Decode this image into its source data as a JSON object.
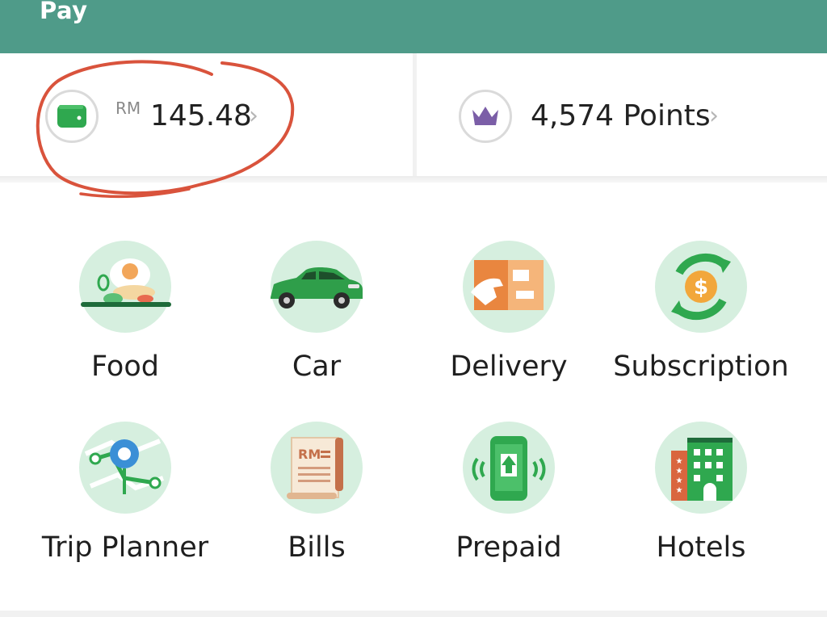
{
  "header": {
    "title": "Pay"
  },
  "wallet": {
    "currency": "RM",
    "amount": "145.48",
    "chevron": "›",
    "icon": "wallet-icon"
  },
  "rewards": {
    "points": "4,574 Points",
    "chevron": "›",
    "icon": "crown-icon"
  },
  "services": [
    {
      "label": "Food",
      "icon": "food-icon"
    },
    {
      "label": "Car",
      "icon": "car-icon"
    },
    {
      "label": "Delivery",
      "icon": "delivery-icon"
    },
    {
      "label": "Subscription",
      "icon": "subscription-icon"
    },
    {
      "label": "Trip Planner",
      "icon": "trip-planner-icon"
    },
    {
      "label": "Bills",
      "icon": "bills-icon"
    },
    {
      "label": "Prepaid",
      "icon": "prepaid-icon"
    },
    {
      "label": "Hotels",
      "icon": "hotels-icon"
    }
  ],
  "colors": {
    "brand": "#4f9b89",
    "accent_green": "#2fa84f",
    "annotation": "#d9533c",
    "crown": "#7b5ea7"
  }
}
